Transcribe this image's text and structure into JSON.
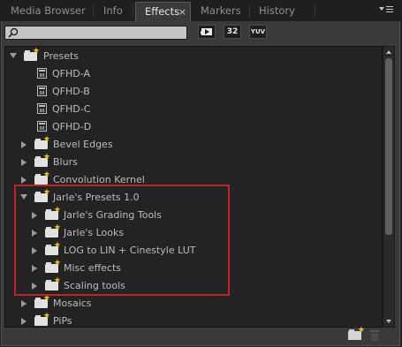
{
  "tabs": [
    {
      "label": "Media Browser",
      "active": false
    },
    {
      "label": "Info",
      "active": false
    },
    {
      "label": "Effects",
      "active": true
    },
    {
      "label": "Markers",
      "active": false
    },
    {
      "label": "History",
      "active": false
    }
  ],
  "tab_close_glyph": "×",
  "search": {
    "value": "",
    "placeholder": ""
  },
  "toolbar": {
    "accelerated_label": "",
    "bit32_label": "32",
    "yuv_label": "YUV"
  },
  "tree": {
    "presets": "Presets",
    "qfhd_a": "QFHD-A",
    "qfhd_b": "QFHD-B",
    "qfhd_c": "QFHD-C",
    "qfhd_d": "QFHD-D",
    "bevel_edges": "Bevel Edges",
    "blurs": "Blurs",
    "convolution_kernel": "Convolution Kernel",
    "jarles_presets": "Jarle's Presets 1.0",
    "jarles_grading_tools": "Jarle's Grading Tools",
    "jarles_looks": "Jarle's Looks",
    "log_to_lin": "LOG to LIN + Cinestyle LUT",
    "misc_effects": "Misc effects",
    "scaling_tools": "Scaling tools",
    "mosaics": "Mosaics",
    "pips": "PiPs"
  },
  "colors": {
    "panel_bg": "#3a3a3a",
    "tree_bg": "#232323",
    "highlight": "#c6202b",
    "folder_star": "#f3c21b"
  },
  "icons": {
    "folder": "bin-folder-icon",
    "preset": "preset-icon",
    "new_bin": "new-custom-bin-icon",
    "delete": "trash-icon"
  }
}
